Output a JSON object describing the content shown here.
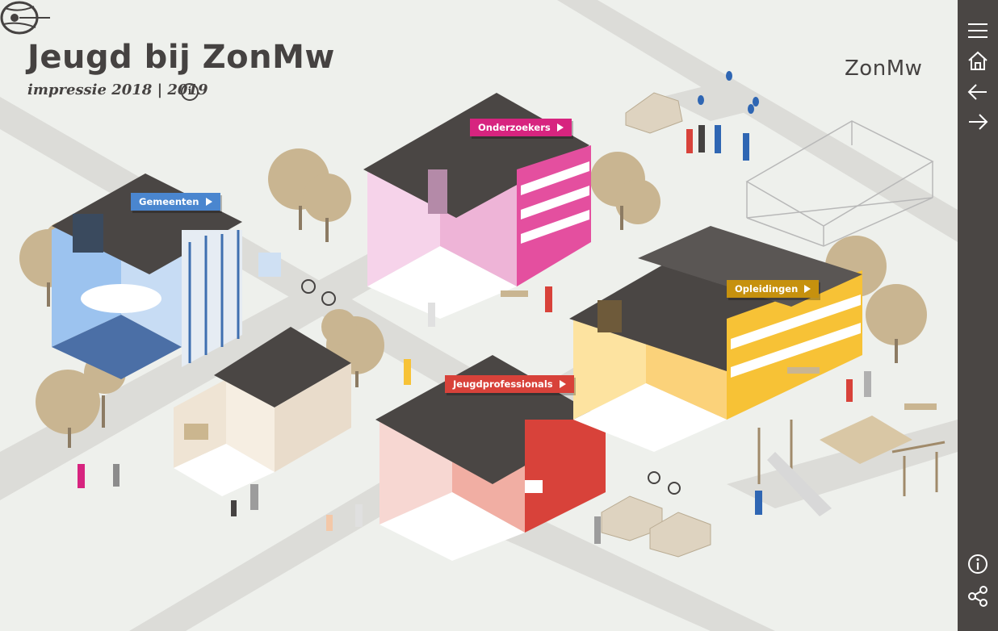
{
  "header": {
    "title": "Jeugd bij ZonMw",
    "subtitle": "impressie 2018 | 2019",
    "info_glyph": "i"
  },
  "logo": {
    "text": "ZonMw"
  },
  "tags": [
    {
      "label": "Gemeenten",
      "color": "#4a86cf"
    },
    {
      "label": "Onderzoekers",
      "color": "#d7247f"
    },
    {
      "label": "Opleidingen",
      "color": "#c6910e"
    },
    {
      "label": "Jeugdprofessionals",
      "color": "#d8423a"
    }
  ],
  "sidebar": {
    "icons": [
      "menu-icon",
      "home-icon",
      "arrow-left-icon",
      "arrow-right-icon",
      "info-icon",
      "share-icon"
    ]
  }
}
